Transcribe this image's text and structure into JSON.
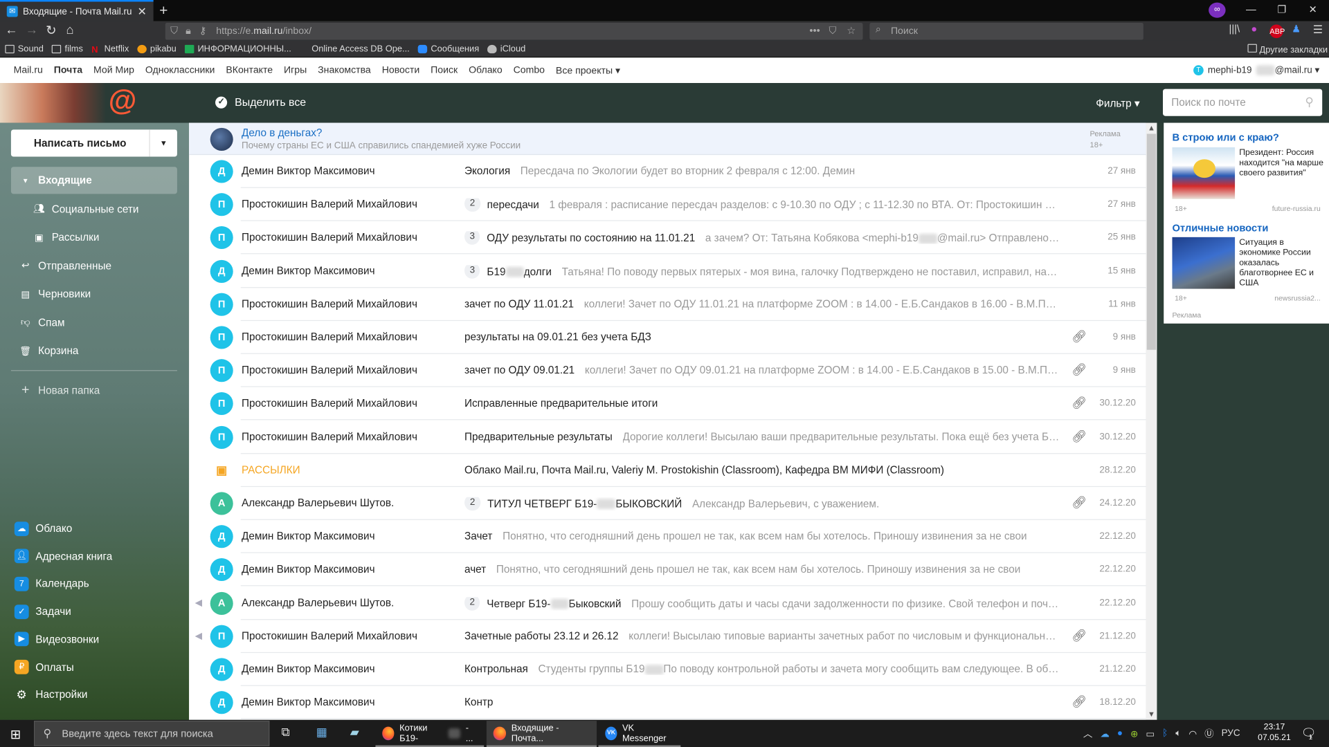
{
  "browser": {
    "tab_title": "Входящие - Почта Mail.ru",
    "url_prefix": "https://e.",
    "url_host": "mail.ru",
    "url_path": "/inbox/",
    "search_placeholder": "Поиск",
    "bookmarks": [
      "Sound",
      "films",
      "Netflix",
      "pikabu",
      "ИНФОРМАЦИОННЫ...",
      "Online Access DB Ope...",
      "Сообщения",
      "iCloud"
    ],
    "other_bookmarks": "Другие закладки"
  },
  "portal": {
    "links": [
      "Mail.ru",
      "Почта",
      "Мой Мир",
      "Одноклассники",
      "ВКонтакте",
      "Игры",
      "Знакомства",
      "Новости",
      "Поиск",
      "Облако",
      "Combo",
      "Все проекты ▾"
    ],
    "current": "Почта",
    "account_prefix": "mephi-b19",
    "account_suffix": "@mail.ru ▾"
  },
  "header": {
    "select_all": "Выделить все",
    "filter": "Фильтр ▾",
    "search_placeholder": "Поиск по почте"
  },
  "sidebar": {
    "compose": "Написать письмо",
    "folders": [
      {
        "label": "Входящие",
        "icon": "triangle-down",
        "selected": true,
        "sub": false
      },
      {
        "label": "Социальные сети",
        "icon": "people",
        "sub": true
      },
      {
        "label": "Рассылки",
        "icon": "newsletter",
        "sub": true
      },
      {
        "label": "Отправленные",
        "icon": "reply",
        "sub": false
      },
      {
        "label": "Черновики",
        "icon": "document",
        "sub": false
      },
      {
        "label": "Спам",
        "icon": "thumbs-down",
        "sub": false
      },
      {
        "label": "Корзина",
        "icon": "trash",
        "sub": false
      }
    ],
    "new_folder": "Новая папка",
    "apps": [
      {
        "label": "Облако",
        "color": "#168de2"
      },
      {
        "label": "Адресная книга",
        "color": "#168de2"
      },
      {
        "label": "Календарь",
        "color": "#168de2"
      },
      {
        "label": "Задачи",
        "color": "#168de2"
      },
      {
        "label": "Видеозвонки",
        "color": "#168de2"
      },
      {
        "label": "Оплаты",
        "color": "#f5a623"
      },
      {
        "label": "Настройки",
        "color": "transparent"
      }
    ]
  },
  "ad_row": {
    "title": "Дело в деньгах?",
    "subtitle": "Почему страны ЕС и США справились спандемией хуже России",
    "mark": "Реклама",
    "age": "18+"
  },
  "colors": {
    "avatar_blue": "#1fc3e8",
    "avatar_green": "#3cc19a",
    "newsletter_orange": "#f5a623",
    "header": "#2a3b36",
    "link": "#1a6fc4"
  },
  "emails": [
    {
      "letter": "Д",
      "color": "blue",
      "sender": "Демин Виктор Максимович",
      "subject": "Экология",
      "snippet": "Пересдача по Экологии будет во вторник 2 февраля с 12:00. Демин",
      "date": "27 янв"
    },
    {
      "letter": "П",
      "color": "blue",
      "sender": "Простокишин Валерий Михайлович",
      "count": "2",
      "subject": "пересдачи",
      "snippet": "1 февраля : расписание пересдач разделов: с 9-10.30 по ОДУ ; с 11-12.30 по ВТА. От: Простокишин Вале",
      "date": "27 янв"
    },
    {
      "letter": "П",
      "color": "blue",
      "sender": "Простокишин Валерий Михайлович",
      "count": "3",
      "subject": "ОДУ результаты по состоянию на 11.01.21",
      "snippet": "а зачем? От: Татьяна Кобякова <mephi-b19",
      "snippet_after": "@mail.ru> Отправлено: 23...",
      "date": "25 янв"
    },
    {
      "letter": "Д",
      "color": "blue",
      "sender": "Демин Виктор Максимович",
      "count": "3",
      "subject": "Б19",
      "subject_after": "долги",
      "snippet": "Татьяна! По поводу первых пятерых - моя вина, галочку Подтверждено не поставил, исправил, надею...",
      "date": "15 янв"
    },
    {
      "letter": "П",
      "color": "blue",
      "sender": "Простокишин Валерий Михайлович",
      "subject": "зачет по ОДУ 11.01.21",
      "snippet": "коллеги! Зачет по ОДУ 11.01.21 на платформе ZOOM : в 14.00 - Е.Б.Сандаков в 16.00 - В.М.Просто...",
      "date": "11 янв"
    },
    {
      "letter": "П",
      "color": "blue",
      "sender": "Простокишин Валерий Михайлович",
      "subject": "результаты на 09.01.21 без учета БДЗ",
      "snippet": "",
      "date": "9 янв",
      "attach": true
    },
    {
      "letter": "П",
      "color": "blue",
      "sender": "Простокишин Валерий Михайлович",
      "subject": "зачет по ОДУ 09.01.21",
      "snippet": "коллеги! Зачет по ОДУ 09.01.21 на платформе ZOOM : в 14.00 - Е.Б.Сандаков в 15.00 - В.М.Просто...",
      "date": "9 янв",
      "attach": true
    },
    {
      "letter": "П",
      "color": "blue",
      "sender": "Простокишин Валерий Михайлович",
      "subject": "Исправленные предварительные итоги",
      "snippet": "",
      "date": "30.12.20",
      "attach": true
    },
    {
      "letter": "П",
      "color": "blue",
      "sender": "Простокишин Валерий Михайлович",
      "subject": "Предварительные результаты",
      "snippet": "Дорогие коллеги! Высылаю ваши предварительные результаты. Пока ещё без учета БДЗ: ...",
      "date": "30.12.20",
      "attach": true
    },
    {
      "newsletter": true,
      "sender": "РАССЫЛКИ",
      "subject": "Облако Mail.ru, Почта Mail.ru, Valeriy M. Prostokishin (Classroom), Кафедра ВМ МИФИ (Classroom)",
      "snippet": "",
      "date": "28.12.20"
    },
    {
      "letter": "А",
      "color": "green",
      "sender": "Александр Валерьевич Шутов.",
      "count": "2",
      "subject": "ТИТУЛ ЧЕТВЕРГ Б19-",
      "subject_after": "БЫКОВСКИЙ",
      "snippet": "Александр Валерьевич, с уважением.",
      "date": "24.12.20",
      "attach": true
    },
    {
      "letter": "Д",
      "color": "blue",
      "sender": "Демин Виктор Максимович",
      "subject": "Зачет",
      "snippet": "Понятно, что сегодняшний день прошел не так, как всем нам бы хотелось. Приношу извинения за не свои",
      "date": "22.12.20"
    },
    {
      "letter": "Д",
      "color": "blue",
      "sender": "Демин Виктор Максимович",
      "subject": "ачет",
      "snippet": "Понятно, что сегодняшний день прошел не так, как всем нам бы хотелось. Приношу извинения за не свои",
      "date": "22.12.20"
    },
    {
      "letter": "А",
      "color": "green",
      "sender": "Александр Валерьевич Шутов.",
      "count": "2",
      "subject": "Четверг Б19-",
      "subject_after": "Быковский",
      "snippet": "Прошу сообщить даты и часы сдачи задолженности по физике. Свой телефон и почту д...",
      "date": "22.12.20",
      "replied": true
    },
    {
      "letter": "П",
      "color": "blue",
      "sender": "Простокишин Валерий Михайлович",
      "subject": "Зачетные работы 23.12 и 26.12",
      "snippet": "коллеги! Высылаю типовые варианты зачетных работ по числовым и функциональным р...",
      "date": "21.12.20",
      "attach": true,
      "replied": true
    },
    {
      "letter": "Д",
      "color": "blue",
      "sender": "Демин Виктор Максимович",
      "subject": "Контрольная",
      "snippet": "Студенты группы Б19",
      "snippet_after": "По поводу контрольной работы и зачета могу сообщить вам следующее. В общем-",
      "date": "21.12.20"
    },
    {
      "letter": "Д",
      "color": "blue",
      "sender": "Демин Виктор Максимович",
      "subject": "Контр",
      "snippet": "",
      "date": "18.12.20",
      "attach": true
    }
  ],
  "right_ad": {
    "items": [
      {
        "title": "В строю или с краю?",
        "text": "Президент: Россия находится \"на марше своего развития\"",
        "age": "18+",
        "source": "future-russia.ru"
      },
      {
        "title": "Отличные новости",
        "text": "Ситуация в экономике России оказалась благотворнее ЕС и США",
        "age": "18+",
        "source": "newsrussia2..."
      }
    ],
    "mark": "Реклама"
  },
  "taskbar": {
    "search_placeholder": "Введите здесь текст для поиска",
    "apps": [
      {
        "label": "Котики Б19-",
        "label_after": "- ..."
      },
      {
        "label": "Входящие - Почта..."
      },
      {
        "label": "VK Messenger"
      }
    ],
    "lang": "РУС",
    "time": "23:17",
    "date": "07.05.21",
    "notifications": "1"
  }
}
